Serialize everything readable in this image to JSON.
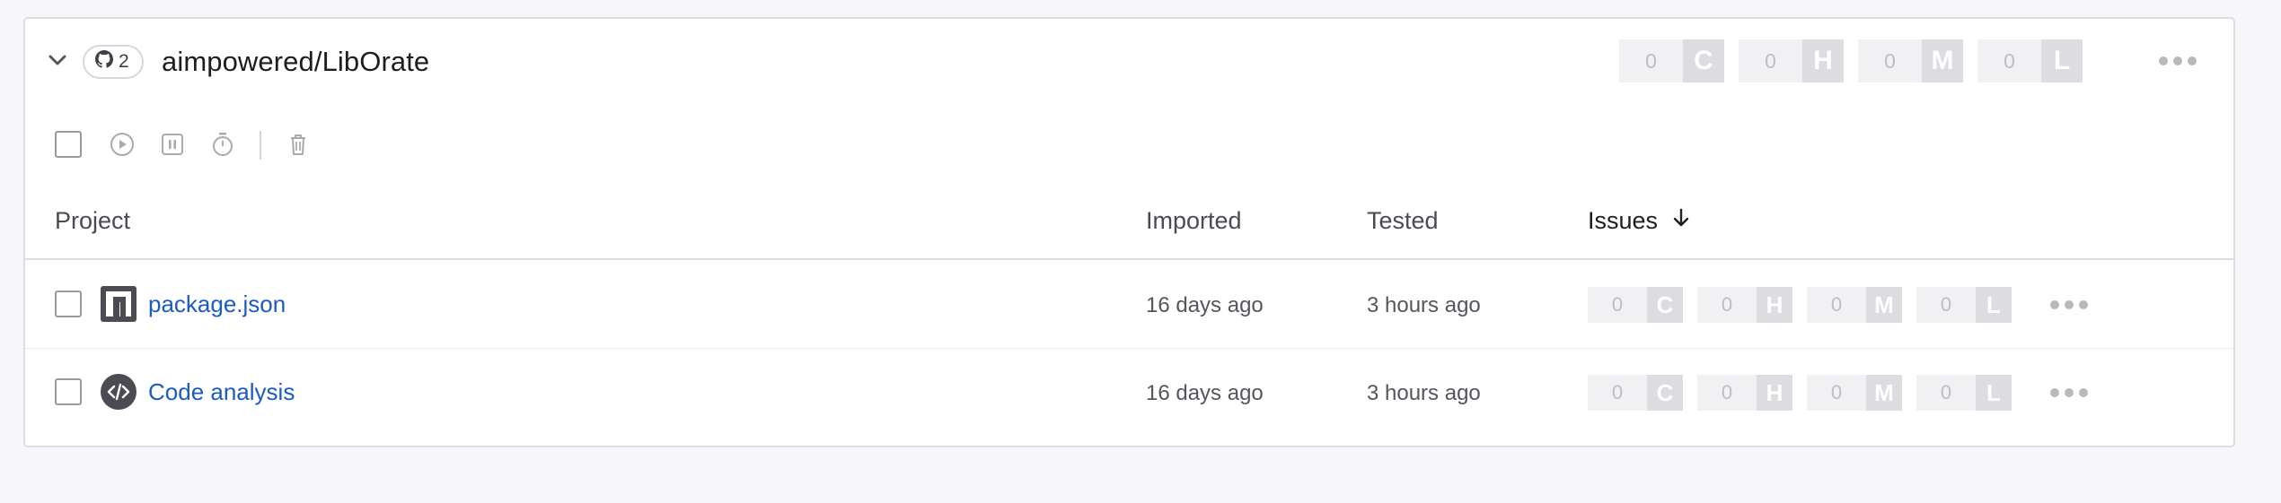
{
  "org": {
    "badge_count": "2",
    "name": "aimpowered/LibOrate",
    "severity": [
      {
        "count": "0",
        "letter": "C"
      },
      {
        "count": "0",
        "letter": "H"
      },
      {
        "count": "0",
        "letter": "M"
      },
      {
        "count": "0",
        "letter": "L"
      }
    ]
  },
  "table": {
    "headers": {
      "project": "Project",
      "imported": "Imported",
      "tested": "Tested",
      "issues": "Issues"
    },
    "rows": [
      {
        "name": "package.json",
        "icon": "npm-icon",
        "imported": "16 days ago",
        "tested": "3 hours ago",
        "severity": [
          {
            "count": "0",
            "letter": "C"
          },
          {
            "count": "0",
            "letter": "H"
          },
          {
            "count": "0",
            "letter": "M"
          },
          {
            "count": "0",
            "letter": "L"
          }
        ]
      },
      {
        "name": "Code analysis",
        "icon": "code-icon",
        "imported": "16 days ago",
        "tested": "3 hours ago",
        "severity": [
          {
            "count": "0",
            "letter": "C"
          },
          {
            "count": "0",
            "letter": "H"
          },
          {
            "count": "0",
            "letter": "M"
          },
          {
            "count": "0",
            "letter": "L"
          }
        ]
      }
    ]
  },
  "toolbar": {
    "icons": [
      "play-icon",
      "pause-icon",
      "stopwatch-icon",
      "trash-icon"
    ]
  },
  "colors": {
    "link": "#1c5bbf",
    "severity_count_bg": "#f1f1f3",
    "severity_letter_bg": "#dddde1"
  }
}
